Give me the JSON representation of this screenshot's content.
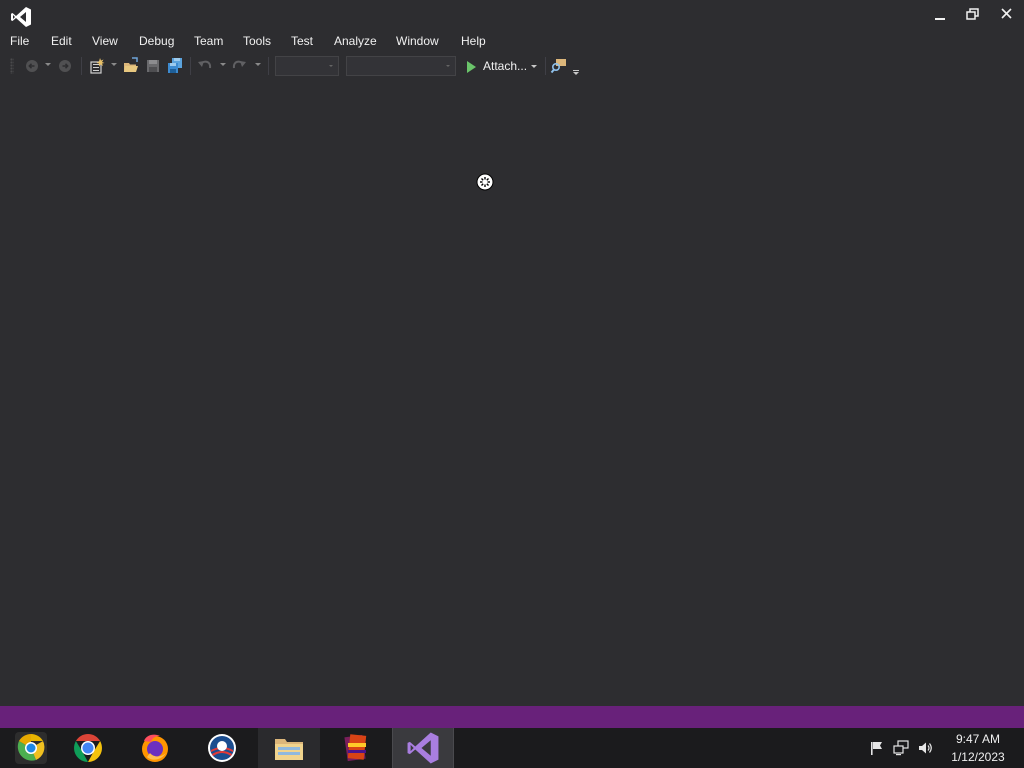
{
  "titlebar": {
    "app_icon": "visual-studio-icon",
    "minimize_icon": "minimize-icon",
    "restore_icon": "restore-icon",
    "close_icon": "close-icon"
  },
  "menu": {
    "items": [
      "File",
      "Edit",
      "View",
      "Debug",
      "Team",
      "Tools",
      "Test",
      "Analyze",
      "Window",
      "Help"
    ]
  },
  "toolbar": {
    "icons": [
      "back-icon",
      "forward-icon",
      "new-project-icon",
      "open-file-icon",
      "save-icon",
      "save-all-icon",
      "undo-icon",
      "redo-icon",
      "find-in-files-icon"
    ],
    "configuration_value": "",
    "platform_value": "",
    "attach_label": "Attach..."
  },
  "statusbar": {
    "accent": "#68217a"
  },
  "taskbar": {
    "apps": [
      "chrome-canary-icon",
      "chrome-icon",
      "firefox-icon",
      "obama-campaign-icon",
      "file-explorer-icon",
      "winrar-icon",
      "visual-studio-icon"
    ],
    "active_app": "visual-studio-icon",
    "tray_icons": [
      "action-center-flag-icon",
      "network-icon",
      "volume-icon"
    ],
    "time": "9:47 AM",
    "date": "1/12/2023"
  },
  "colors": {
    "background": "#2d2d30",
    "taskbar": "#1b1b1d",
    "accent": "#68217a"
  }
}
